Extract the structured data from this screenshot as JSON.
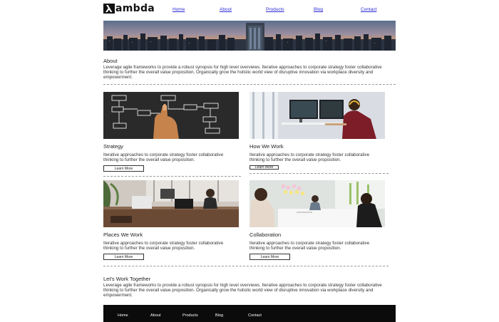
{
  "brand": {
    "logo_text": "ambda",
    "logo_icon": "lambda-icon"
  },
  "nav": [
    {
      "label": "Home"
    },
    {
      "label": "About"
    },
    {
      "label": "Products"
    },
    {
      "label": "Blog"
    },
    {
      "label": "Contact"
    }
  ],
  "about": {
    "title": "About",
    "text": "Leverage agile frameworks to provide a robust synopsis for high level overviews. Iterative approaches to corporate strategy foster collaborative thinking to further the overall value proposition. Organically grow the holistic world view of disruptive innovation via workplace diversity and empowerment."
  },
  "cards": [
    {
      "title": "Strategy",
      "text": "Iterative approaches to corporate strategy foster collaborative thinking to further the overall value proposition.",
      "button": "Learn More"
    },
    {
      "title": "How We Work",
      "text": "Iterative approaches to corporate strategy foster collaborative thinking to further the overall value proposition.",
      "button": "Learn More"
    },
    {
      "title": "Places We Work",
      "text": "Iterative approaches to corporate strategy foster collaborative thinking to further the overall value proposition.",
      "button": "Learn More"
    },
    {
      "title": "Collaboration",
      "text": "Iterative approaches to corporate strategy foster collaborative thinking to further the overall value proposition.",
      "button": "Learn More"
    }
  ],
  "together": {
    "title": "Let's Work Together",
    "text": "Leverage agile frameworks to provide a robust synopsis for high level overviews. Iterative approaches to corporate strategy foster collaborative thinking to further the overall value proposition. Organically grow the holistic world view of disruptive innovation via workplace diversity and empowerment."
  },
  "footer_nav": [
    {
      "label": "Home"
    },
    {
      "label": "About"
    },
    {
      "label": "Products"
    },
    {
      "label": "Blog"
    },
    {
      "label": "Contact"
    }
  ],
  "colors": {
    "link": "#2a2ad6",
    "footer_bg": "#0b0b0b",
    "text": "#222222"
  }
}
